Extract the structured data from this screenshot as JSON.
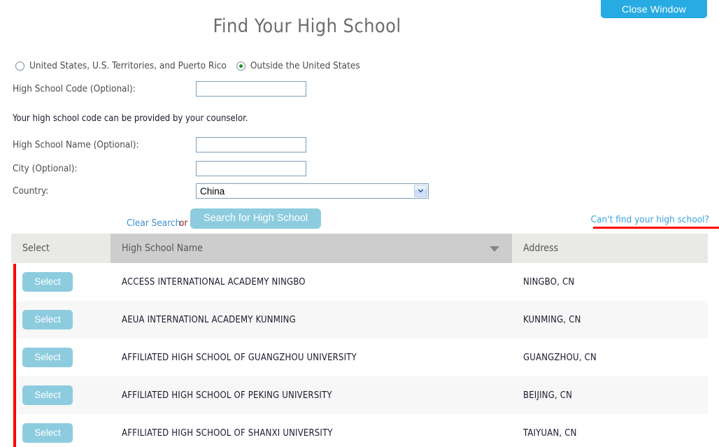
{
  "header": {
    "close_window_label": "Close Window",
    "title": "Find Your High School"
  },
  "colors": {
    "close_button": "#27abe2",
    "action_button": "#8dccdf",
    "link": "#3ba3de",
    "annotation": "#ff0000",
    "header_row_active": "#cdcdcd",
    "header_row": "#e9e9e5"
  },
  "location_scope": {
    "options": [
      {
        "label": "United States, U.S. Territories, and Puerto Rico",
        "checked": false
      },
      {
        "label": "Outside the United States",
        "checked": true
      }
    ]
  },
  "form": {
    "code": {
      "label": "High School Code (Optional):",
      "value": "",
      "placeholder": ""
    },
    "code_note": "Your high school code can be provided by your counselor.",
    "name": {
      "label": "High School Name (Optional):",
      "value": "",
      "placeholder": ""
    },
    "city": {
      "label": "City (Optional):",
      "value": "",
      "placeholder": ""
    },
    "country": {
      "label": "Country:",
      "selected": "China"
    }
  },
  "actions": {
    "clear_search": "Clear Search",
    "or": "or",
    "search_button": "Search for High School",
    "cant_find": "Can't find your high school?"
  },
  "results": {
    "columns": [
      "Select",
      "High School Name",
      "Address"
    ],
    "sorted_column": "High School Name",
    "sort_direction": "desc",
    "row_button_label": "Select",
    "rows": [
      {
        "name": "ACCESS INTERNATIONAL ACADEMY NINGBO",
        "address": "NINGBO, CN"
      },
      {
        "name": "AEUA INTERNATIONL ACADEMY KUNMING",
        "address": "KUNMING, CN"
      },
      {
        "name": "AFFILIATED HIGH SCHOOL OF GUANGZHOU UNIVERSITY",
        "address": "GUANGZHOU, CN"
      },
      {
        "name": "AFFILIATED HIGH SCHOOL OF PEKING UNIVERSITY",
        "address": "BEIJING, CN"
      },
      {
        "name": "AFFILIATED HIGH SCHOOL OF SHANXI UNIVERSITY",
        "address": "TAIYUAN, CN"
      }
    ]
  }
}
